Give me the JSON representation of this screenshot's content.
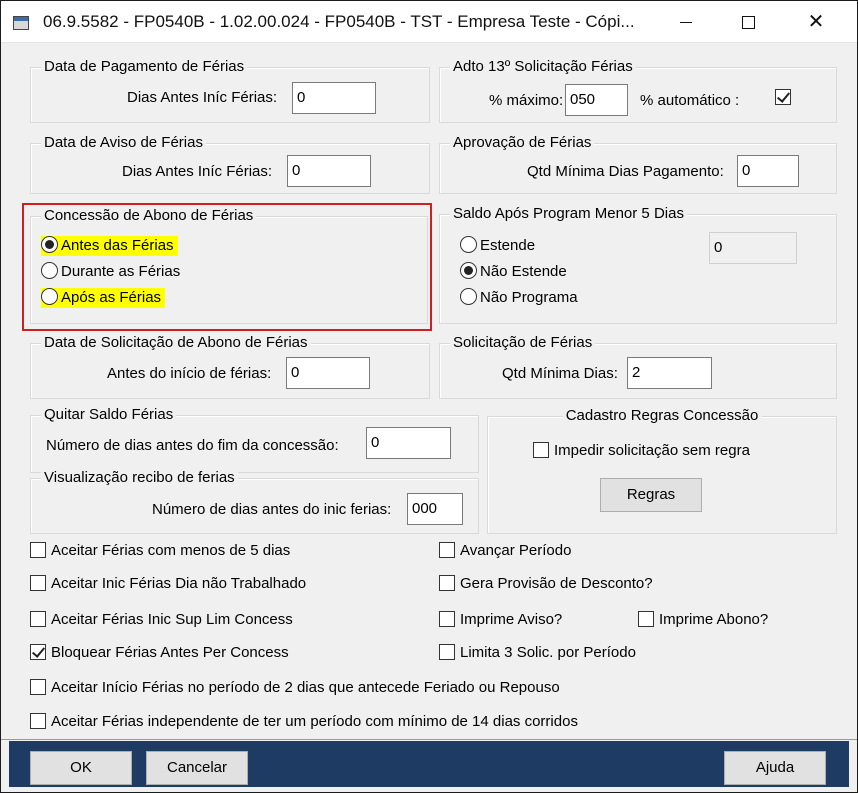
{
  "window": {
    "title": "06.9.5582 - FP0540B - 1.02.00.024 - FP0540B - TST - Empresa Teste - Cópi...",
    "minimize": "",
    "maximize": "",
    "close": "✕"
  },
  "pagamento": {
    "legend": "Data de Pagamento de Férias",
    "label": "Dias Antes Iníc Férias:",
    "value": "0"
  },
  "aviso": {
    "legend": "Data de Aviso de Férias",
    "label": "Dias Antes Iníc Férias:",
    "value": "0"
  },
  "adto": {
    "legend": "Adto 13º Solicitação Férias",
    "max_label": "% máximo:",
    "max_value": "050",
    "auto_label": "% automático :",
    "auto_checked": true
  },
  "aprovacao": {
    "legend": "Aprovação de Férias",
    "label": "Qtd Mínima Dias Pagamento:",
    "value": "0"
  },
  "abono": {
    "legend": "Concessão de Abono de Férias",
    "options": [
      {
        "label": "Antes das Férias",
        "selected": true,
        "highlight": true
      },
      {
        "label": "Durante as Férias",
        "selected": false,
        "highlight": false
      },
      {
        "label": "Após as Férias",
        "selected": false,
        "highlight": true
      }
    ],
    "annotation_color": "#d11f1f",
    "highlight_color": "#ffff00"
  },
  "saldo": {
    "legend": "Saldo Após Program Menor 5 Dias",
    "options": [
      {
        "label": "Estende",
        "selected": false
      },
      {
        "label": "Não Estende",
        "selected": true
      },
      {
        "label": "Não Programa",
        "selected": false
      }
    ],
    "value": "0"
  },
  "solic_abono": {
    "legend": "Data de Solicitação de Abono de Férias",
    "label": "Antes do início de férias:",
    "value": "0"
  },
  "solicitacao": {
    "legend": "Solicitação de Férias",
    "label": "Qtd Mínima Dias:",
    "value": "2"
  },
  "quitar": {
    "legend": "Quitar Saldo Férias",
    "label": "Número de dias antes do fim da concessão:",
    "value": "0"
  },
  "visualizacao": {
    "legend": "Visualização recibo de ferias",
    "label": "Número de dias antes do inic ferias:",
    "value": "000"
  },
  "cadastro": {
    "legend": "Cadastro Regras Concessão",
    "checkbox_label": "Impedir solicitação sem regra",
    "checked": false,
    "button": "Regras"
  },
  "checks": [
    {
      "label": "Aceitar Férias com menos de 5 dias",
      "checked": false
    },
    {
      "label": "Aceitar Inic Férias Dia não Trabalhado",
      "checked": false
    },
    {
      "label": "Aceitar Férias Inic Sup Lim Concess",
      "checked": false
    },
    {
      "label": "Bloquear Férias Antes Per Concess",
      "checked": true
    },
    {
      "label": "Aceitar Início Férias no período de 2 dias que antecede Feriado ou Repouso",
      "checked": false
    },
    {
      "label": "Aceitar Férias independente de ter um período com mínimo de 14 dias corridos",
      "checked": false
    },
    {
      "label": "Avançar Período",
      "checked": false
    },
    {
      "label": "Gera Provisão de Desconto?",
      "checked": false
    },
    {
      "label": "Imprime Aviso?",
      "checked": false
    },
    {
      "label": "Imprime Abono?",
      "checked": false
    },
    {
      "label": "Limita 3 Solic. por Período",
      "checked": false
    }
  ],
  "footer": {
    "ok": "OK",
    "cancel": "Cancelar",
    "help": "Ajuda",
    "bar_color": "#1e3c63"
  }
}
